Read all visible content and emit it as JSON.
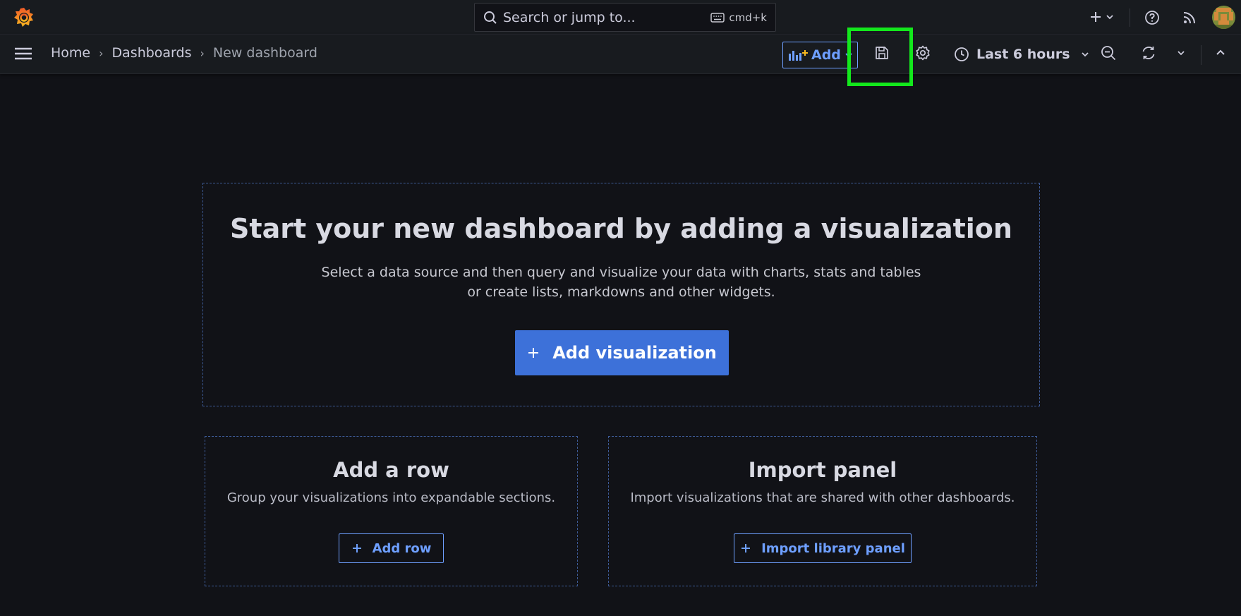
{
  "topbar": {
    "search_placeholder": "Search or jump to...",
    "search_shortcut": "cmd+k"
  },
  "breadcrumb": {
    "home": "Home",
    "dashboards": "Dashboards",
    "current": "New dashboard"
  },
  "toolbar": {
    "add_label": "Add",
    "time_range": "Last 6 hours"
  },
  "empty_state": {
    "title": "Start your new dashboard by adding a visualization",
    "desc_line1": "Select a data source and then query and visualize your data with charts, stats and tables",
    "desc_line2": "or create lists, markdowns and other widgets.",
    "button": "Add visualization"
  },
  "add_row_card": {
    "title": "Add a row",
    "desc": "Group your visualizations into expandable sections.",
    "button": "Add row"
  },
  "import_card": {
    "title": "Import panel",
    "desc": "Import visualizations that are shared with other dashboards.",
    "button": "Import library panel"
  },
  "colors": {
    "background": "#111217",
    "panel": "#181b1f",
    "primary": "#3d71d9",
    "link": "#6e9fff",
    "highlight": "#13e81c"
  }
}
